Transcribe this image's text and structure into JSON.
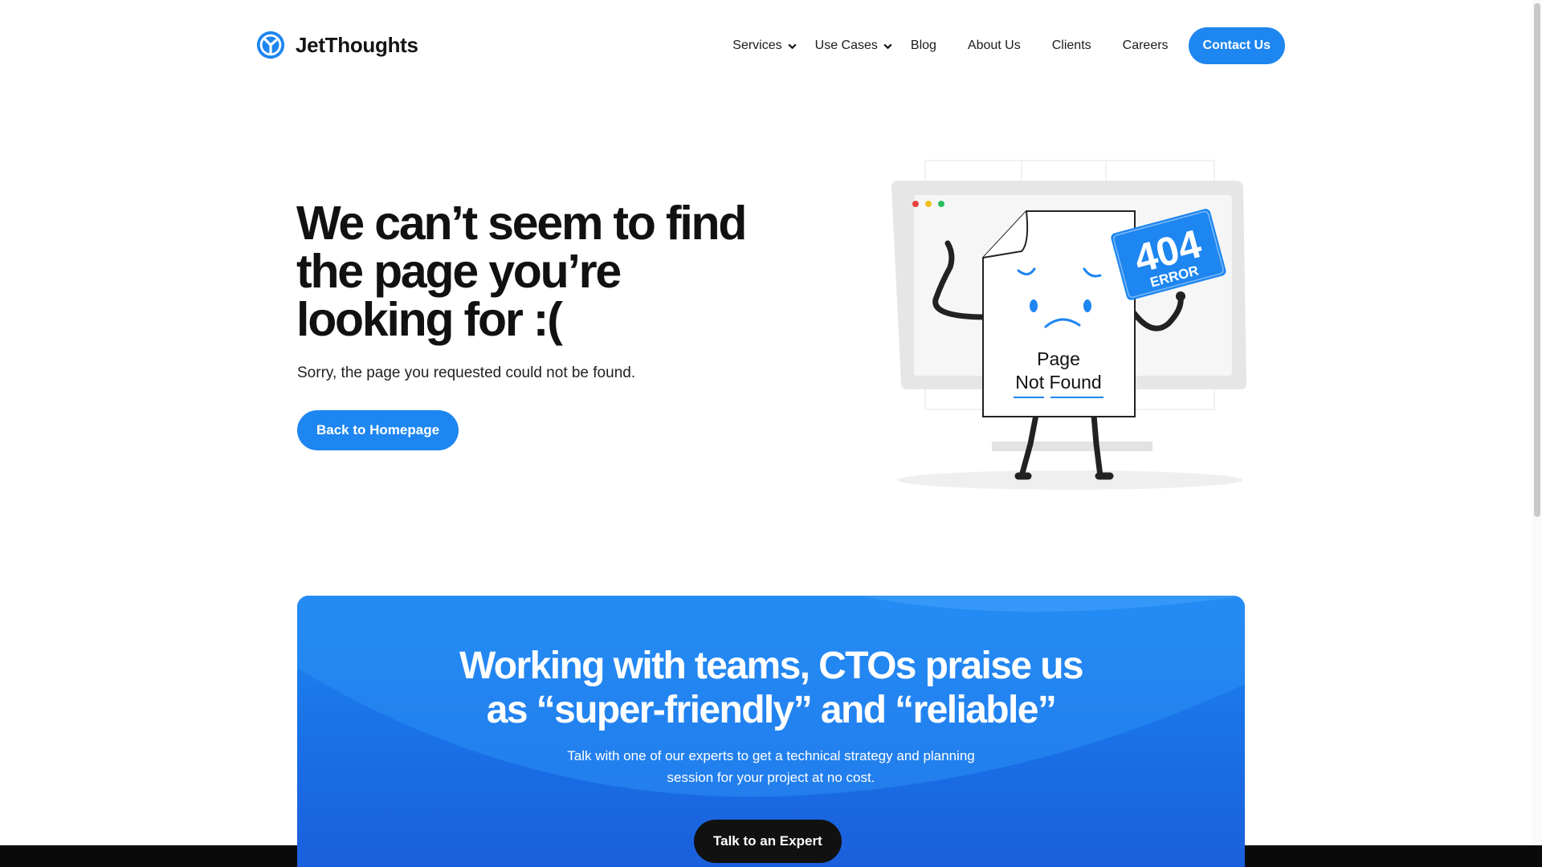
{
  "brand": {
    "name": "JetThoughts",
    "accent": "#1e86f0"
  },
  "nav": {
    "items": [
      {
        "label": "Services",
        "dropdown": true
      },
      {
        "label": "Use Cases",
        "dropdown": true
      },
      {
        "label": "Blog"
      },
      {
        "label": "About Us"
      },
      {
        "label": "Clients"
      },
      {
        "label": "Careers"
      }
    ],
    "contact_label": "Contact Us"
  },
  "hero": {
    "title_lines": [
      "We can’t seem to find",
      "the page you’re",
      "looking for :("
    ],
    "subtitle": "Sorry, the page you requested could not be found.",
    "button_label": "Back to Homepage"
  },
  "illustration": {
    "badge_number": "404",
    "badge_text": "ERROR",
    "page_line1": "Page",
    "page_line2": "Not Found"
  },
  "cta": {
    "title_lines": [
      "Working with teams, CTOs praise us",
      "as “super-friendly” and “reliable”"
    ],
    "subtitle_lines": [
      "Talk with one of our experts to get a technical strategy and planning",
      "session for your project at no cost."
    ],
    "button_label": "Talk to an Expert"
  },
  "icons": [
    "logo-icon",
    "chevron-down-icon"
  ]
}
